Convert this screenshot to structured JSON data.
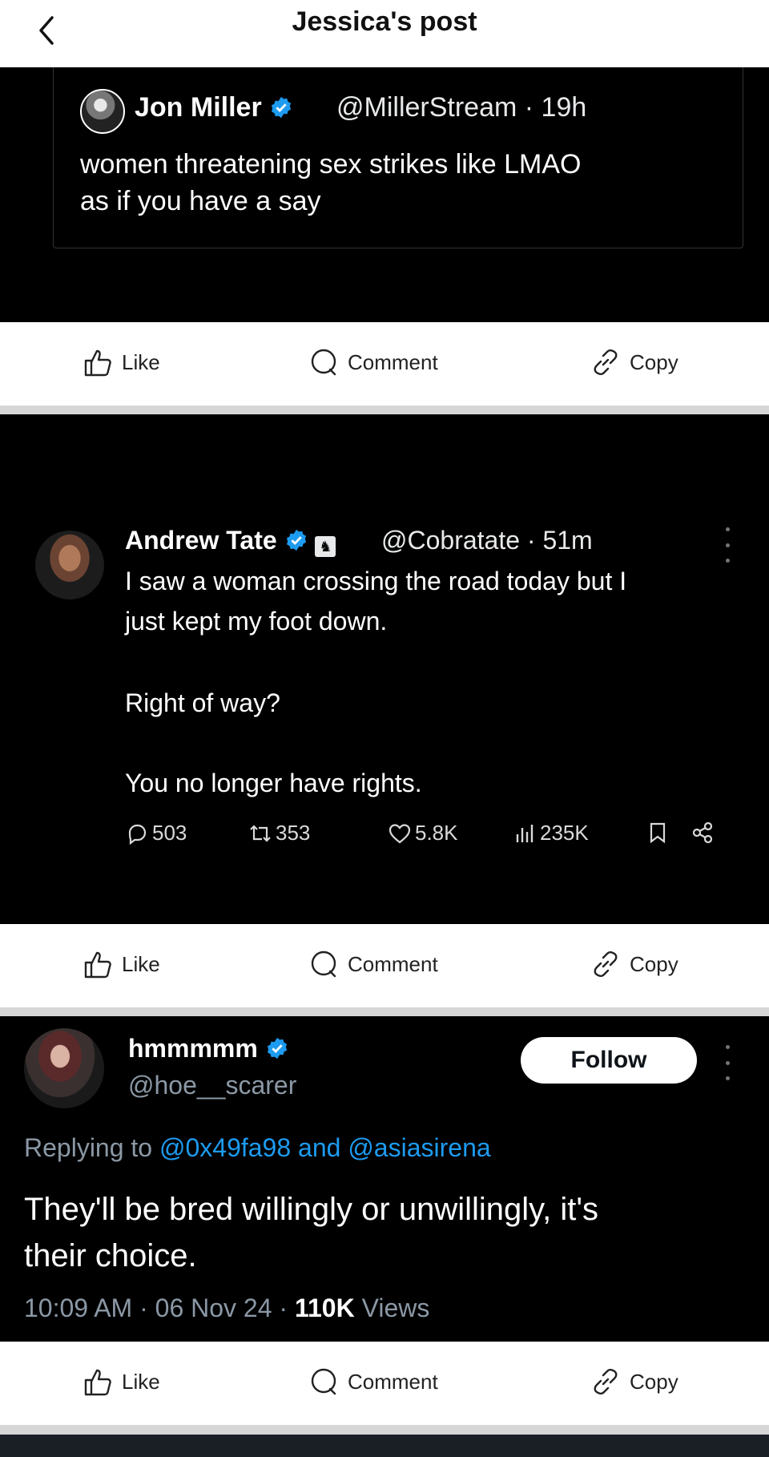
{
  "header": {
    "title": "Jessica's post"
  },
  "quoted_post": {
    "name": "Jon Miller",
    "handle": "@MillerStream",
    "time": "19h",
    "text_line1": "women threatening sex strikes like LMAO",
    "text_line2": "as if you have a say"
  },
  "actions": {
    "like": "Like",
    "comment": "Comment",
    "copy": "Copy"
  },
  "tate_post": {
    "name": "Andrew Tate",
    "handle": "@Cobratate",
    "time": "51m",
    "line1": "I saw a woman crossing the road today but I",
    "line2": "just kept my foot down.",
    "line3": "Right of way?",
    "line4": "You no longer have rights.",
    "stats": {
      "replies": "503",
      "reposts": "353",
      "likes": "5.8K",
      "views": "235K"
    }
  },
  "reply_post": {
    "name": "hmmmmm",
    "handle": "@hoe__scarer",
    "follow_label": "Follow",
    "replying_prefix": "Replying to",
    "replying_user1": "@0x49fa98",
    "replying_and": "and",
    "replying_user2": "@asiasirena",
    "text_line1": "They'll be bred willingly or unwillingly, it's",
    "text_line2": "their choice.",
    "time": "10:09 AM",
    "date": "06 Nov 24",
    "views_count": "110K",
    "views_label": "Views"
  },
  "colors": {
    "accent": "#1d9bf0",
    "background_dark": "#000000",
    "verified": "#1d9bf0"
  },
  "icons": [
    "back-arrow-icon",
    "verified-icon",
    "thumbs-up-icon",
    "comment-bubble-icon",
    "link-icon",
    "reply-icon",
    "repost-icon",
    "heart-icon",
    "views-icon",
    "bookmark-icon",
    "share-icon",
    "more-icon"
  ]
}
